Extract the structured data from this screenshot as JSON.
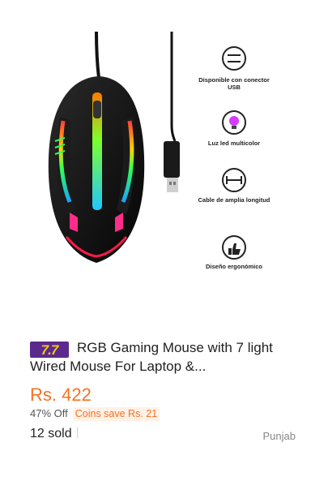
{
  "product": {
    "badge": "7.7",
    "title": "RGB Gaming Mouse with 7 light Wired Mouse For Laptop &...",
    "price": "Rs. 422",
    "discount": "47% Off",
    "coins": "Coins save Rs. 21",
    "sold": "12 sold",
    "location": "Punjab"
  },
  "image": {
    "features": [
      {
        "icon": "usb-icon",
        "label": "Disponible con conector USB"
      },
      {
        "icon": "rgb-led-icon",
        "label": "Luz led multicolor"
      },
      {
        "icon": "cable-length-icon",
        "label": "Cable de amplia longitud"
      },
      {
        "icon": "thumbs-up-icon",
        "label": "Diseño ergonómico"
      }
    ]
  },
  "colors": {
    "price": "#f57224",
    "badge_bg": "#5b2a8c",
    "badge_text": "#f5c518"
  }
}
